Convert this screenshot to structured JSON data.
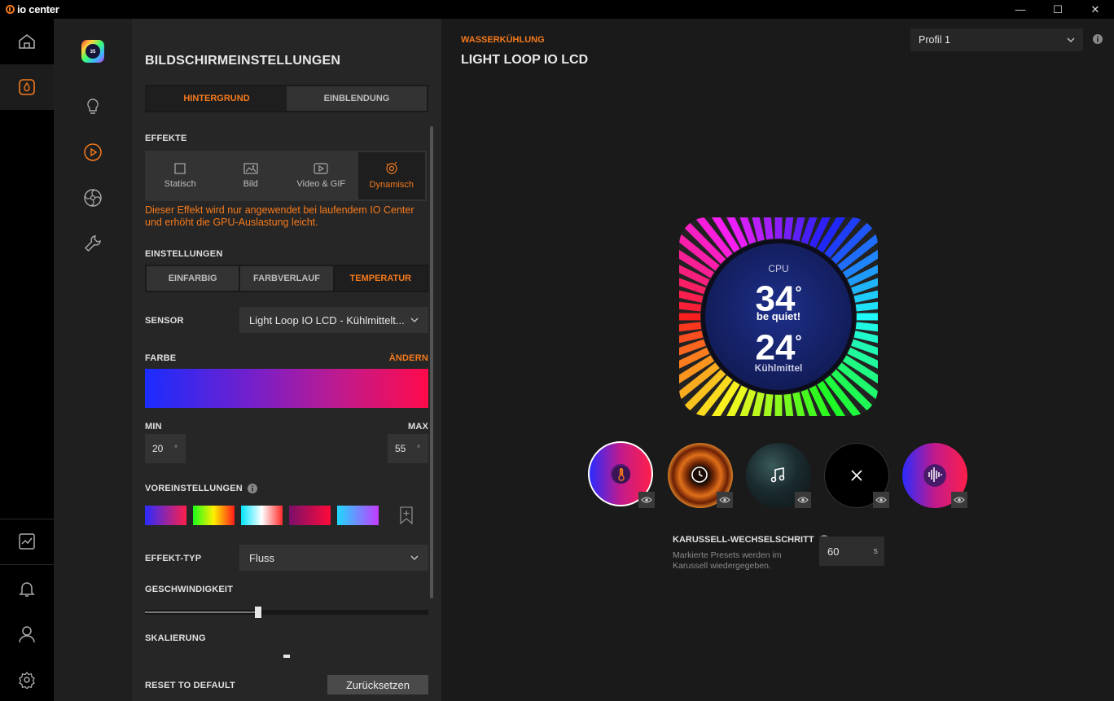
{
  "app": {
    "logo_text": "io center",
    "window_buttons": {
      "minimize": "—",
      "maximize": "☐",
      "close": "✕"
    }
  },
  "colors": {
    "accent": "#f57a1c",
    "panel": "#262626",
    "bg": "#1a1a1a"
  },
  "left_nav": [
    "home-icon",
    "water-drop-icon",
    "activity-chart-icon",
    "bell-icon",
    "user-icon",
    "settings-gear-icon"
  ],
  "sub_nav": [
    "lcd-device-icon",
    "lightbulb-icon",
    "play-circle-icon",
    "fan-icon",
    "wrench-icon"
  ],
  "panel": {
    "title": "BILDSCHIRMEINSTELLUNGEN",
    "tabs": [
      {
        "label": "HINTERGRUND",
        "selected": true
      },
      {
        "label": "EINBLENDUNG",
        "selected": false
      }
    ],
    "effects_label": "EFFEKTE",
    "effects": [
      {
        "label": "Statisch",
        "icon": "square-icon",
        "selected": false
      },
      {
        "label": "Bild",
        "icon": "image-icon",
        "selected": false
      },
      {
        "label": "Video & GIF",
        "icon": "video-icon",
        "selected": false
      },
      {
        "label": "Dynamisch",
        "icon": "dynamic-icon",
        "selected": true
      }
    ],
    "warning_line1": "Dieser Effekt wird nur angewendet bei laufendem IO Center",
    "warning_line2": "und erhöht die GPU-Auslastung leicht.",
    "settings_label": "EINSTELLUNGEN",
    "mode_tabs": [
      {
        "label": "EINFARBIG",
        "selected": false
      },
      {
        "label": "FARBVERLAUF",
        "selected": false
      },
      {
        "label": "TEMPERATUR",
        "selected": true
      }
    ],
    "sensor_label": "SENSOR",
    "sensor_value": "Light Loop IO LCD - Kühlmittelt...",
    "color_label": "FARBE",
    "change_label": "ÄNDERN",
    "min_label": "MIN",
    "max_label": "MAX",
    "min_value": "20",
    "max_value": "55",
    "degree_unit": "°",
    "presets_label": "VOREINSTELLUNGEN",
    "effect_type_label": "EFFEKT-TYP",
    "effect_type_value": "Fluss",
    "speed_label": "GESCHWINDIGKEIT",
    "speed_fraction": 0.4,
    "scaling_label": "SKALIERUNG",
    "reset_label": "RESET TO DEFAULT",
    "reset_button": "Zurücksetzen"
  },
  "main": {
    "category": "WASSERKÜHLUNG",
    "device": "LIGHT LOOP IO LCD",
    "profile": "Profil 1",
    "lcd": {
      "top_label": "CPU",
      "value1": "34",
      "brand": "be quiet!",
      "value2": "24",
      "bottom_label": "Kühlmittel",
      "degree": "°"
    },
    "carousel_label": "KARUSSELL-WECHSELSCHRITT",
    "carousel_hint_line1": "Markierte Presets werden im",
    "carousel_hint_line2": "Karussell wiedergegeben.",
    "carousel_value": "60",
    "carousel_unit": "s",
    "presets": [
      "thermometer-icon",
      "clock-icon",
      "music-note-icon",
      "close-x-icon",
      "audio-wave-icon"
    ]
  }
}
